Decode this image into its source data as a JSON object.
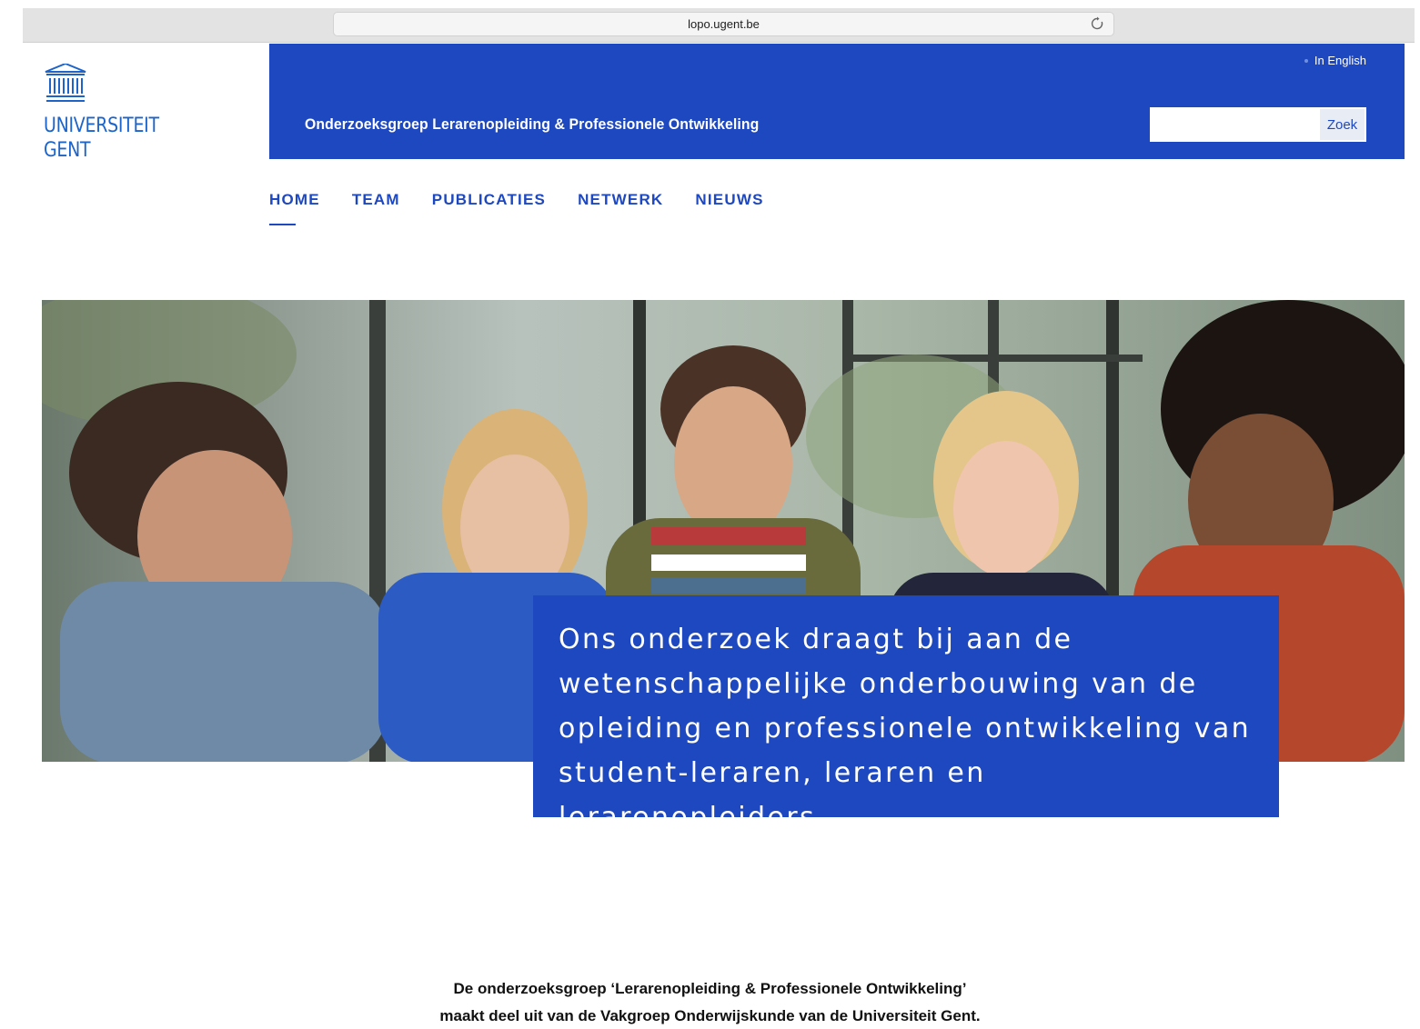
{
  "browser": {
    "url": "lopo.ugent.be",
    "reload_icon": "reload-icon"
  },
  "logo": {
    "icon": "university-building-icon",
    "line1": "UNIVERSITEIT",
    "line2": "GENT"
  },
  "header": {
    "language_link": "In English",
    "group_title": "Onderzoeksgroep Lerarenopleiding & Professionele Ontwikkeling",
    "search": {
      "placeholder": "",
      "button_label": "Zoek"
    }
  },
  "nav": {
    "items": [
      {
        "label": "HOME",
        "active": true
      },
      {
        "label": "TEAM",
        "active": false
      },
      {
        "label": "PUBLICATIES",
        "active": false
      },
      {
        "label": "NETWERK",
        "active": false
      },
      {
        "label": "NIEUWS",
        "active": false
      }
    ]
  },
  "hero": {
    "line1": "Ons onderzoek draagt bij aan de",
    "line2": "wetenschappelijke onderbouwing van de",
    "line3": "opleiding en professionele ontwikkeling van",
    "line4": "student-leraren, leraren en lerarenopleiders."
  },
  "intro": {
    "line1": "De onderzoeksgroep ‘Lerarenopleiding & Professionele Ontwikkeling’",
    "line2": "maakt deel uit van de Vakgroep Onderwijskunde van de Universiteit Gent."
  },
  "colors": {
    "brand_blue": "#1e48c0",
    "logo_blue": "#1e64c8"
  }
}
